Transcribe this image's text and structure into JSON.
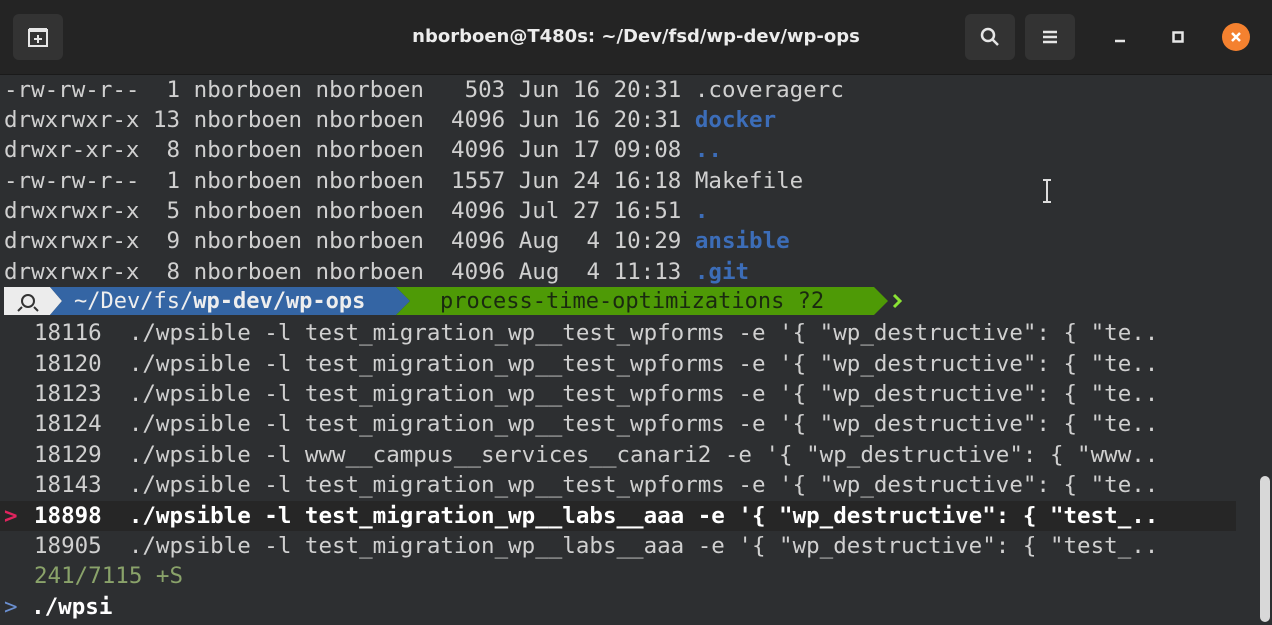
{
  "window": {
    "title": "nborboen@T480s: ~/Dev/fsd/wp-dev/wp-ops"
  },
  "listing": [
    "-rw-rw-r--  1 nborboen nborboen   503 Jun 16 20:31 ",
    "drwxrwxr-x 13 nborboen nborboen  4096 Jun 16 20:31 ",
    "drwxr-xr-x  8 nborboen nborboen  4096 Jun 17 09:08 ",
    "-rw-rw-r--  1 nborboen nborboen  1557 Jun 24 16:18 ",
    "drwxrwxr-x  5 nborboen nborboen  4096 Jul 27 16:51 ",
    "drwxrwxr-x  9 nborboen nborboen  4096 Aug  4 10:29 ",
    "drwxrwxr-x  8 nborboen nborboen  4096 Aug  4 11:13 "
  ],
  "listing_names": [
    ".coveragerc",
    "docker",
    "..",
    "Makefile",
    ".",
    "ansible",
    ".git"
  ],
  "prompt": {
    "path_prefix": "~/Dev/fs/",
    "path_bold": "wp-dev/wp-ops",
    "branch": "process-time-optimizations ?2"
  },
  "history": [
    "18116  ./wpsible -l test_migration_wp__test_wpforms -e '{ \"wp_destructive\": { \"te..",
    "18120  ./wpsible -l test_migration_wp__test_wpforms -e '{ \"wp_destructive\": { \"te..",
    "18123  ./wpsible -l test_migration_wp__test_wpforms -e '{ \"wp_destructive\": { \"te..",
    "18124  ./wpsible -l test_migration_wp__test_wpforms -e '{ \"wp_destructive\": { \"te..",
    "18129  ./wpsible -l www__campus__services__canari2 -e '{ \"wp_destructive\": { \"www..",
    "18143  ./wpsible -l test_migration_wp__test_wpforms -e '{ \"wp_destructive\": { \"te..",
    "18898  ./wpsible -l test_migration_wp__labs__aaa -e '{ \"wp_destructive\": { \"test_..",
    "18905  ./wpsible -l test_migration_wp__labs__aaa -e '{ \"wp_destructive\": { \"test_.."
  ],
  "selected_index": 6,
  "selected_marker": ">",
  "count": "241/7115 +S",
  "input": {
    "marker": ">",
    "query": "./wpsi"
  },
  "colors": {
    "accent_close": "#f4812f",
    "dir_blue": "#3c6db8",
    "prompt_blue": "#3465a4",
    "prompt_green": "#4e9a06"
  },
  "icons": [
    "new-tab-icon",
    "search-icon",
    "menu-icon",
    "minimize-icon",
    "maximize-icon",
    "close-icon",
    "linux-icon"
  ]
}
